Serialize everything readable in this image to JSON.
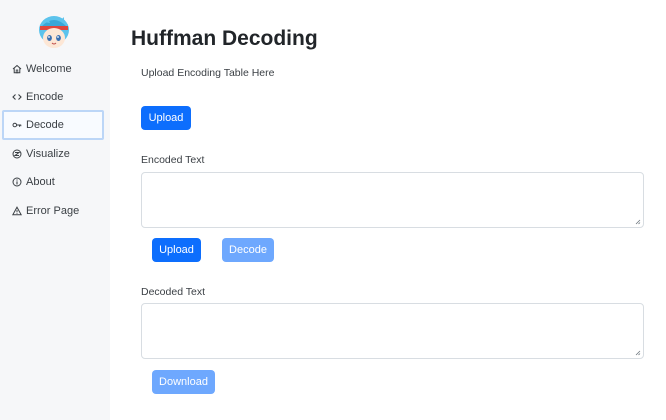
{
  "sidebar": {
    "items": [
      {
        "label": "Welcome",
        "icon": "home-icon"
      },
      {
        "label": "Encode",
        "icon": "code-icon"
      },
      {
        "label": "Decode",
        "icon": "key-icon",
        "active": true
      },
      {
        "label": "Visualize",
        "icon": "visualize-icon"
      },
      {
        "label": "About",
        "icon": "info-icon"
      },
      {
        "label": "Error Page",
        "icon": "warning-icon"
      }
    ]
  },
  "main": {
    "title": "Huffman Decoding",
    "upload_table_label": "Upload Encoding Table Here",
    "upload_table_button": "Upload",
    "encoded_label": "Encoded Text",
    "encoded_value": "",
    "encoded_upload_button": "Upload",
    "decode_button": "Decode",
    "decoded_label": "Decoded Text",
    "decoded_value": "",
    "download_button": "Download"
  },
  "colors": {
    "primary": "#0d6efd",
    "primary_disabled": "#6ea8fe",
    "sidebar_bg": "#f6f7f9",
    "active_border": "#bcd6f7"
  }
}
